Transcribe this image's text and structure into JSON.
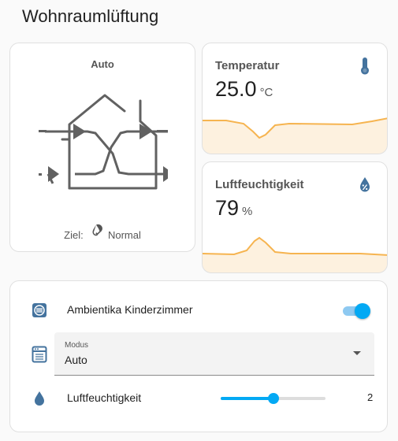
{
  "page": {
    "title": "Wohnraumlüftung"
  },
  "ventilation": {
    "mode": "Auto",
    "target_label": "Ziel:",
    "target_value": "Normal",
    "icon": "ventilation-house-icon"
  },
  "temperature": {
    "name": "Temperatur",
    "value": "25.0",
    "unit": "°C",
    "icon": "thermometer-icon",
    "accent": "#f6b450"
  },
  "humidity": {
    "name": "Luftfeuchtigkeit",
    "value": "79",
    "unit": "%",
    "icon": "water-percent-icon",
    "accent": "#f6b450"
  },
  "controls": {
    "device_name": "Ambientika Kinderzimmer",
    "device_icon": "fan-icon",
    "switch_on": true,
    "mode_select": {
      "label": "Modus",
      "value": "Auto",
      "icon": "dishwasher-icon"
    },
    "humidity_slider": {
      "label": "Luftfeuchtigkeit",
      "value": "2",
      "fraction": 0.5,
      "icon": "water-icon"
    }
  },
  "colors": {
    "primary": "#03a9f4",
    "icon_blue": "#44739e",
    "graph": "#f6b450"
  }
}
